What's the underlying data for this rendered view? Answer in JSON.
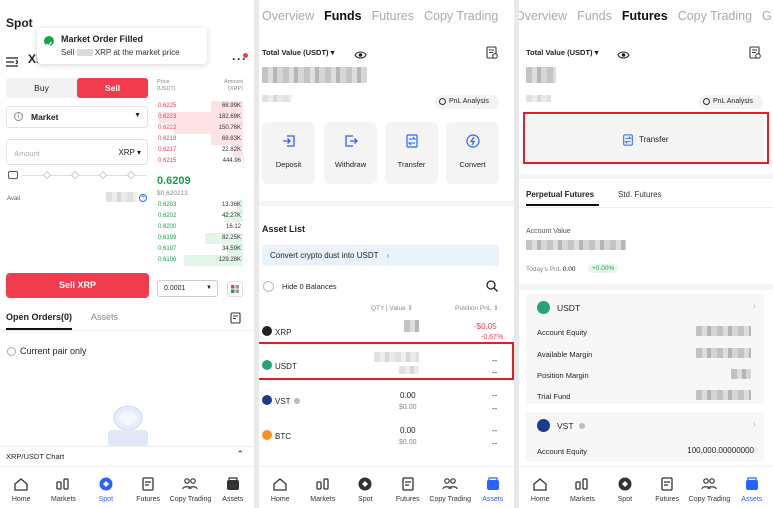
{
  "panel1": {
    "title": "Spot",
    "toast": {
      "title": "Market Order Filled",
      "text_pre": "Sell",
      "text_post": "XRP at the market price"
    },
    "pair_short": "XI",
    "buy_label": "Buy",
    "sell_label": "Sell",
    "order_type": "Market",
    "amount_placeholder": "Amount",
    "amount_unit": "XRP",
    "avail_label": "Avail.",
    "ob_header_price": "Price\n(USDT)",
    "ob_header_amount": "Amount\n(XRP)",
    "asks": [
      {
        "price": "0.6225",
        "amount": "68.99K"
      },
      {
        "price": "0.6223",
        "amount": "182.69K"
      },
      {
        "price": "0.6222",
        "amount": "150.76K"
      },
      {
        "price": "0.6218",
        "amount": "69.83K"
      },
      {
        "price": "0.6217",
        "amount": "22.82K"
      },
      {
        "price": "0.6215",
        "amount": "444.96"
      }
    ],
    "mid_price": "0.6209",
    "mid_price_usd": "$0.620213",
    "bids": [
      {
        "price": "0.6203",
        "amount": "13.36K"
      },
      {
        "price": "0.6202",
        "amount": "42.27K"
      },
      {
        "price": "0.6200",
        "amount": "16.12"
      },
      {
        "price": "0.6199",
        "amount": "82.25K"
      },
      {
        "price": "0.6197",
        "amount": "34.59K"
      },
      {
        "price": "0.6196",
        "amount": "129.28K"
      }
    ],
    "sell_button": "Sell XRP",
    "precision": "0.0001",
    "tab_open_orders": "Open Orders(0)",
    "tab_assets": "Assets",
    "current_pair_only": "Current pair only",
    "chart_bar": "XRP/USDT Chart"
  },
  "panel2": {
    "tabs": [
      "Overview",
      "Funds",
      "Futures",
      "Copy Trading"
    ],
    "total_value_label": "Total Value (USDT)",
    "pnl_analysis": "PnL Analysis",
    "actions": [
      "Deposit",
      "Withdraw",
      "Transfer",
      "Convert"
    ],
    "asset_list_title": "Asset List",
    "convert_banner": "Convert crypto dust into USDT",
    "hide_zero": "Hide 0 Balances",
    "col_qty": "QTY | Value",
    "col_pnl": "Position PnL",
    "assets": [
      {
        "name": "XRP",
        "qty": "",
        "value": "",
        "pnl": "-$0.05",
        "pnl2": "-0.67%"
      },
      {
        "name": "USDT",
        "qty": "",
        "value": "",
        "pnl": "--",
        "pnl2": "--"
      },
      {
        "name": "VST",
        "qty": "0.00",
        "value": "$0.00",
        "pnl": "--",
        "pnl2": "--"
      },
      {
        "name": "BTC",
        "qty": "0.00",
        "value": "$0.00",
        "pnl": "--",
        "pnl2": "--"
      }
    ]
  },
  "panel3": {
    "tabs": [
      "Overview",
      "Funds",
      "Futures",
      "Copy Trading",
      "G"
    ],
    "total_value_label": "Total Value (USDT)",
    "pnl_analysis": "PnL Analysis",
    "transfer_button": "Transfer",
    "subtab_perpetual": "Perpetual Futures",
    "subtab_std": "Std. Futures",
    "account_value_label": "Account Value",
    "todays_pnl_label": "Today's PnL",
    "todays_pnl_value": "0.00",
    "todays_pnl_pct": "+0.00%",
    "usdt_card": {
      "name": "USDT",
      "rows": [
        "Account Equity",
        "Available Margin",
        "Position Margin",
        "Trial Fund"
      ]
    },
    "vst_card": {
      "name": "VST",
      "row": "Account Equity",
      "value": "100,000.00000000"
    }
  },
  "nav": [
    "Home",
    "Markets",
    "Spot",
    "Futures",
    "Copy Trading",
    "Assets"
  ],
  "colors": {
    "accent": "#2962ff",
    "sell": "#f23b4c",
    "buy": "#16a34a",
    "highlight": "#e11d2a"
  }
}
